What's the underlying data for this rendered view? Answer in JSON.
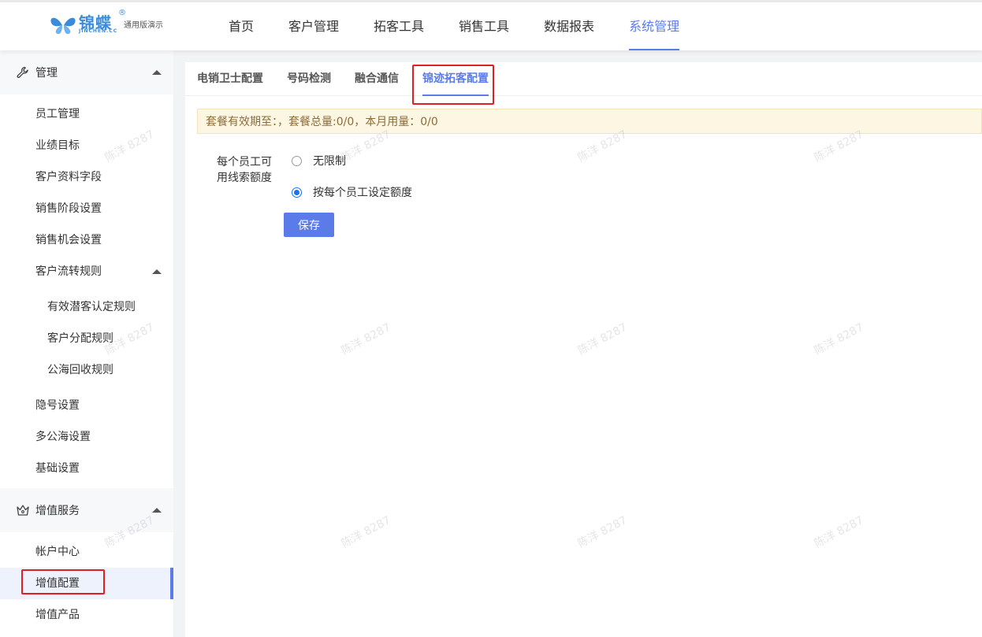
{
  "header": {
    "logo": {
      "brand": "锦蝶",
      "registered": "®",
      "domain": "JINCHEN.CC",
      "subtitle": "通用版演示"
    },
    "nav": [
      {
        "label": "首页"
      },
      {
        "label": "客户管理"
      },
      {
        "label": "拓客工具"
      },
      {
        "label": "销售工具"
      },
      {
        "label": "数据报表"
      },
      {
        "label": "系统管理",
        "active": true
      }
    ]
  },
  "sidebar": {
    "section_manage": "管理",
    "manage_items": [
      "员工管理",
      "业绩目标",
      "客户资料字段",
      "销售阶段设置",
      "销售机会设置"
    ],
    "customer_flow": "客户流转规则",
    "customer_flow_items": [
      "有效潜客认定规则",
      "客户分配规则",
      "公海回收规则"
    ],
    "more_items": [
      "隐号设置",
      "多公海设置",
      "基础设置"
    ],
    "section_value": "增值服务",
    "value_items": [
      "帐户中心",
      "增值配置",
      "增值产品"
    ],
    "active_item": "增值配置"
  },
  "main": {
    "tabs": [
      "电销卫士配置",
      "号码检测",
      "融合通信",
      "锦迹拓客配置"
    ],
    "active_tab": "锦迹拓客配置",
    "notice": "套餐有效期至：，套餐总量:0/0，本月用量：0/0",
    "form_label_line1": "每个员工可",
    "form_label_line2": "用线索额度",
    "options": [
      "无限制",
      "按每个员工设定额度"
    ],
    "selected_option": "按每个员工设定额度",
    "save_label": "保存"
  },
  "watermark": "陈洋 8287",
  "colors": {
    "accent": "#5b7ce8",
    "highlight_box": "#e02020",
    "notice_bg": "#fdf6e3"
  }
}
